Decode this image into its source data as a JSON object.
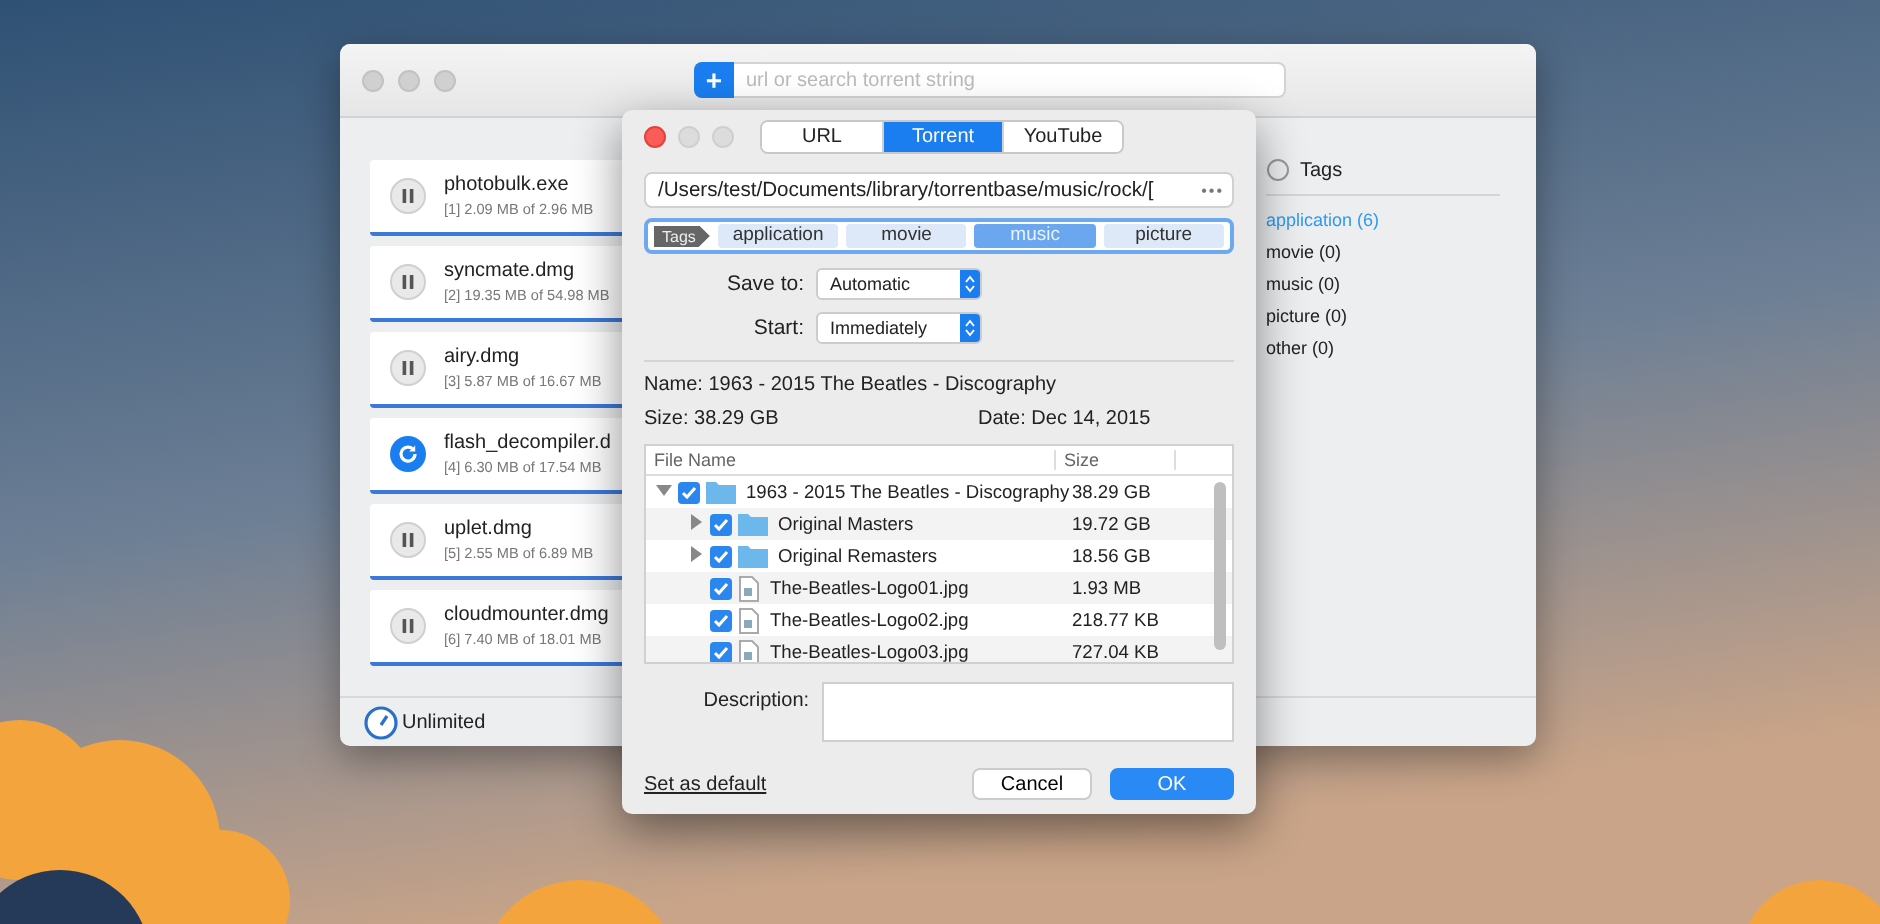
{
  "main_window": {
    "add_button": "+",
    "search": {
      "placeholder": "url or search torrent string"
    },
    "downloads": [
      {
        "name": "photobulk.exe",
        "info": "[1] 2.09 MB of 2.96 MB",
        "kind": "paused"
      },
      {
        "name": "syncmate.dmg",
        "info": "[2] 19.35 MB of 54.98 MB",
        "kind": "paused"
      },
      {
        "name": "airy.dmg",
        "info": "[3] 5.87 MB of 16.67 MB",
        "kind": "paused"
      },
      {
        "name": "flash_decompiler.d",
        "info": "[4] 6.30 MB of 17.54 MB",
        "kind": "loading"
      },
      {
        "name": "uplet.dmg",
        "info": "[5] 2.55 MB of 6.89 MB",
        "kind": "paused"
      },
      {
        "name": "cloudmounter.dmg",
        "info": "[6] 7.40 MB of 18.01 MB",
        "kind": "paused"
      }
    ],
    "tags_panel": {
      "title": "Tags",
      "items": [
        {
          "label": "application (6)",
          "selected": true
        },
        {
          "label": "movie (0)",
          "selected": false
        },
        {
          "label": "music (0)",
          "selected": false
        },
        {
          "label": "picture (0)",
          "selected": false
        },
        {
          "label": "other (0)",
          "selected": false
        }
      ]
    },
    "speed_limit": "Unlimited"
  },
  "dialog": {
    "tabs": [
      {
        "label": "URL",
        "selected": false
      },
      {
        "label": "Torrent",
        "selected": true
      },
      {
        "label": "YouTube",
        "selected": false
      }
    ],
    "path": "/Users/test/Documents/library/torrentbase/music/rock/[",
    "more_button": "•••",
    "tags_label": "Tags",
    "tags": [
      {
        "label": "application",
        "selected": false
      },
      {
        "label": "movie",
        "selected": false
      },
      {
        "label": "music",
        "selected": true
      },
      {
        "label": "picture",
        "selected": false
      }
    ],
    "save_to": {
      "label": "Save to:",
      "value": "Automatic"
    },
    "start": {
      "label": "Start:",
      "value": "Immediately"
    },
    "name": {
      "label": "Name:",
      "value": "1963 - 2015 The Beatles - Discography"
    },
    "size": {
      "label": "Size:",
      "value": "38.29 GB"
    },
    "date": {
      "label": "Date:",
      "value": "Dec 14, 2015"
    },
    "files": {
      "columns": [
        "File Name",
        "Size"
      ],
      "rows": [
        {
          "name": "1963 - 2015 The Beatles - Discography",
          "size": "38.29 GB",
          "kind": "folder",
          "checked": true,
          "expanded": true,
          "children": [
            {
              "name": "Original Masters",
              "size": "19.72 GB",
              "kind": "folder",
              "checked": true,
              "expanded": false
            },
            {
              "name": "Original Remasters",
              "size": "18.56 GB",
              "kind": "folder",
              "checked": true,
              "expanded": false
            },
            {
              "name": "The-Beatles-Logo01.jpg",
              "size": "1.93 MB",
              "kind": "file",
              "checked": true
            },
            {
              "name": "The-Beatles-Logo02.jpg",
              "size": "218.77 KB",
              "kind": "file",
              "checked": true
            },
            {
              "name": "The-Beatles-Logo03.jpg",
              "size": "727.04 KB",
              "kind": "file",
              "checked": true
            }
          ]
        }
      ]
    },
    "description": {
      "label": "Description:"
    },
    "set_default": "Set as default",
    "buttons": [
      {
        "label": "Cancel",
        "kind": "secondary"
      },
      {
        "label": "OK",
        "kind": "primary"
      }
    ]
  }
}
